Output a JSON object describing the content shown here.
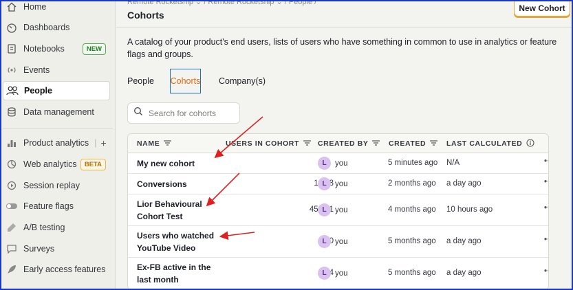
{
  "sidebar": {
    "items": [
      {
        "label": "Home",
        "icon": "home-icon"
      },
      {
        "label": "Dashboards",
        "icon": "dashboard-icon"
      },
      {
        "label": "Notebooks",
        "icon": "notebook-icon",
        "badge": "NEW"
      },
      {
        "label": "Events",
        "icon": "events-icon"
      },
      {
        "label": "People",
        "icon": "people-icon"
      },
      {
        "label": "Data management",
        "icon": "database-icon"
      },
      {
        "label": "Product analytics",
        "icon": "bar-chart-icon"
      },
      {
        "label": "Web analytics",
        "icon": "pie-chart-icon",
        "badge": "BETA"
      },
      {
        "label": "Session replay",
        "icon": "replay-icon"
      },
      {
        "label": "Feature flags",
        "icon": "toggle-icon"
      },
      {
        "label": "A/B testing",
        "icon": "flask-icon"
      },
      {
        "label": "Surveys",
        "icon": "chat-icon"
      },
      {
        "label": "Early access features",
        "icon": "rocket-icon"
      }
    ]
  },
  "header": {
    "breadcrumb": "Remote Rocketship  ⌄  /  Remote Rocketship  ⌄  /  People  /",
    "title": "Cohorts",
    "new_cohort_label": "New Cohort"
  },
  "description": "A catalog of your product's end users, lists of users who have something in common to use in analytics or feature flags and groups.",
  "tabs": [
    "People",
    "Cohorts",
    "Company(s)"
  ],
  "search": {
    "placeholder": "Search for cohorts"
  },
  "table": {
    "headers": [
      "NAME",
      "USERS IN COHORT",
      "CREATED BY",
      "CREATED",
      "LAST CALCULATED"
    ],
    "rows": [
      {
        "name": "My new cohort",
        "users": "",
        "created_by": "you",
        "avatar": "L",
        "created": "5 minutes ago",
        "last_calculated": "N/A"
      },
      {
        "name": "Conversions",
        "users": "1,178",
        "created_by": "you",
        "avatar": "L",
        "created": "2 months ago",
        "last_calculated": "a day ago"
      },
      {
        "name": "Lior Behavioural Cohort Test",
        "users": "45,441",
        "created_by": "you",
        "avatar": "L",
        "created": "4 months ago",
        "last_calculated": "10 hours ago"
      },
      {
        "name": "Users who watched YouTube Video",
        "users": "480",
        "created_by": "you",
        "avatar": "L",
        "created": "5 months ago",
        "last_calculated": "a day ago"
      },
      {
        "name": "Ex-FB active in the last month",
        "users": "54",
        "created_by": "you",
        "avatar": "L",
        "created": "5 months ago",
        "last_calculated": "a day ago"
      }
    ],
    "more_label": "•••"
  },
  "colors": {
    "accent": "#e8690b",
    "annotation": "#e0201e",
    "frame": "#1a37c4"
  }
}
